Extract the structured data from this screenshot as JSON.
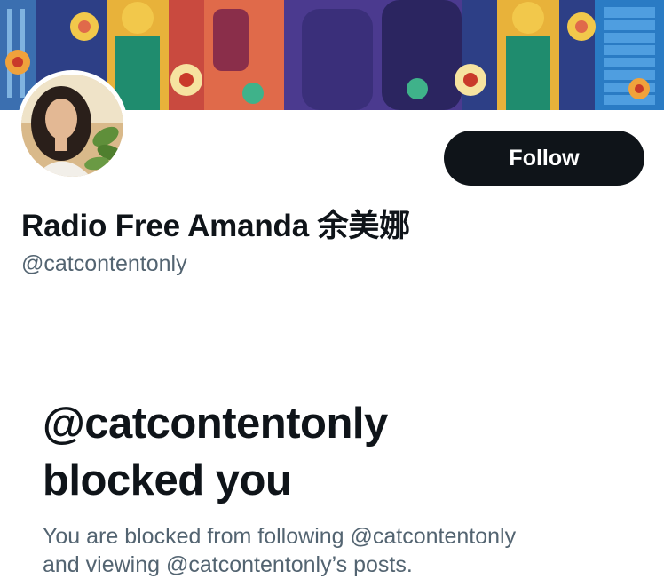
{
  "profile": {
    "display_name": "Radio Free Amanda 余美娜",
    "handle": "@catcontentonly",
    "follow_label": "Follow"
  },
  "blocked_notice": {
    "title_line1": "@catcontentonly",
    "title_line2": "blocked you",
    "description_line1": "You are blocked from following @catcontentonly",
    "description_line2": "and viewing @catcontentonly’s posts."
  },
  "colors": {
    "primary_text": "#0f1419",
    "secondary_text": "#536471",
    "follow_button_bg": "#0f1419",
    "follow_button_text": "#ffffff"
  }
}
